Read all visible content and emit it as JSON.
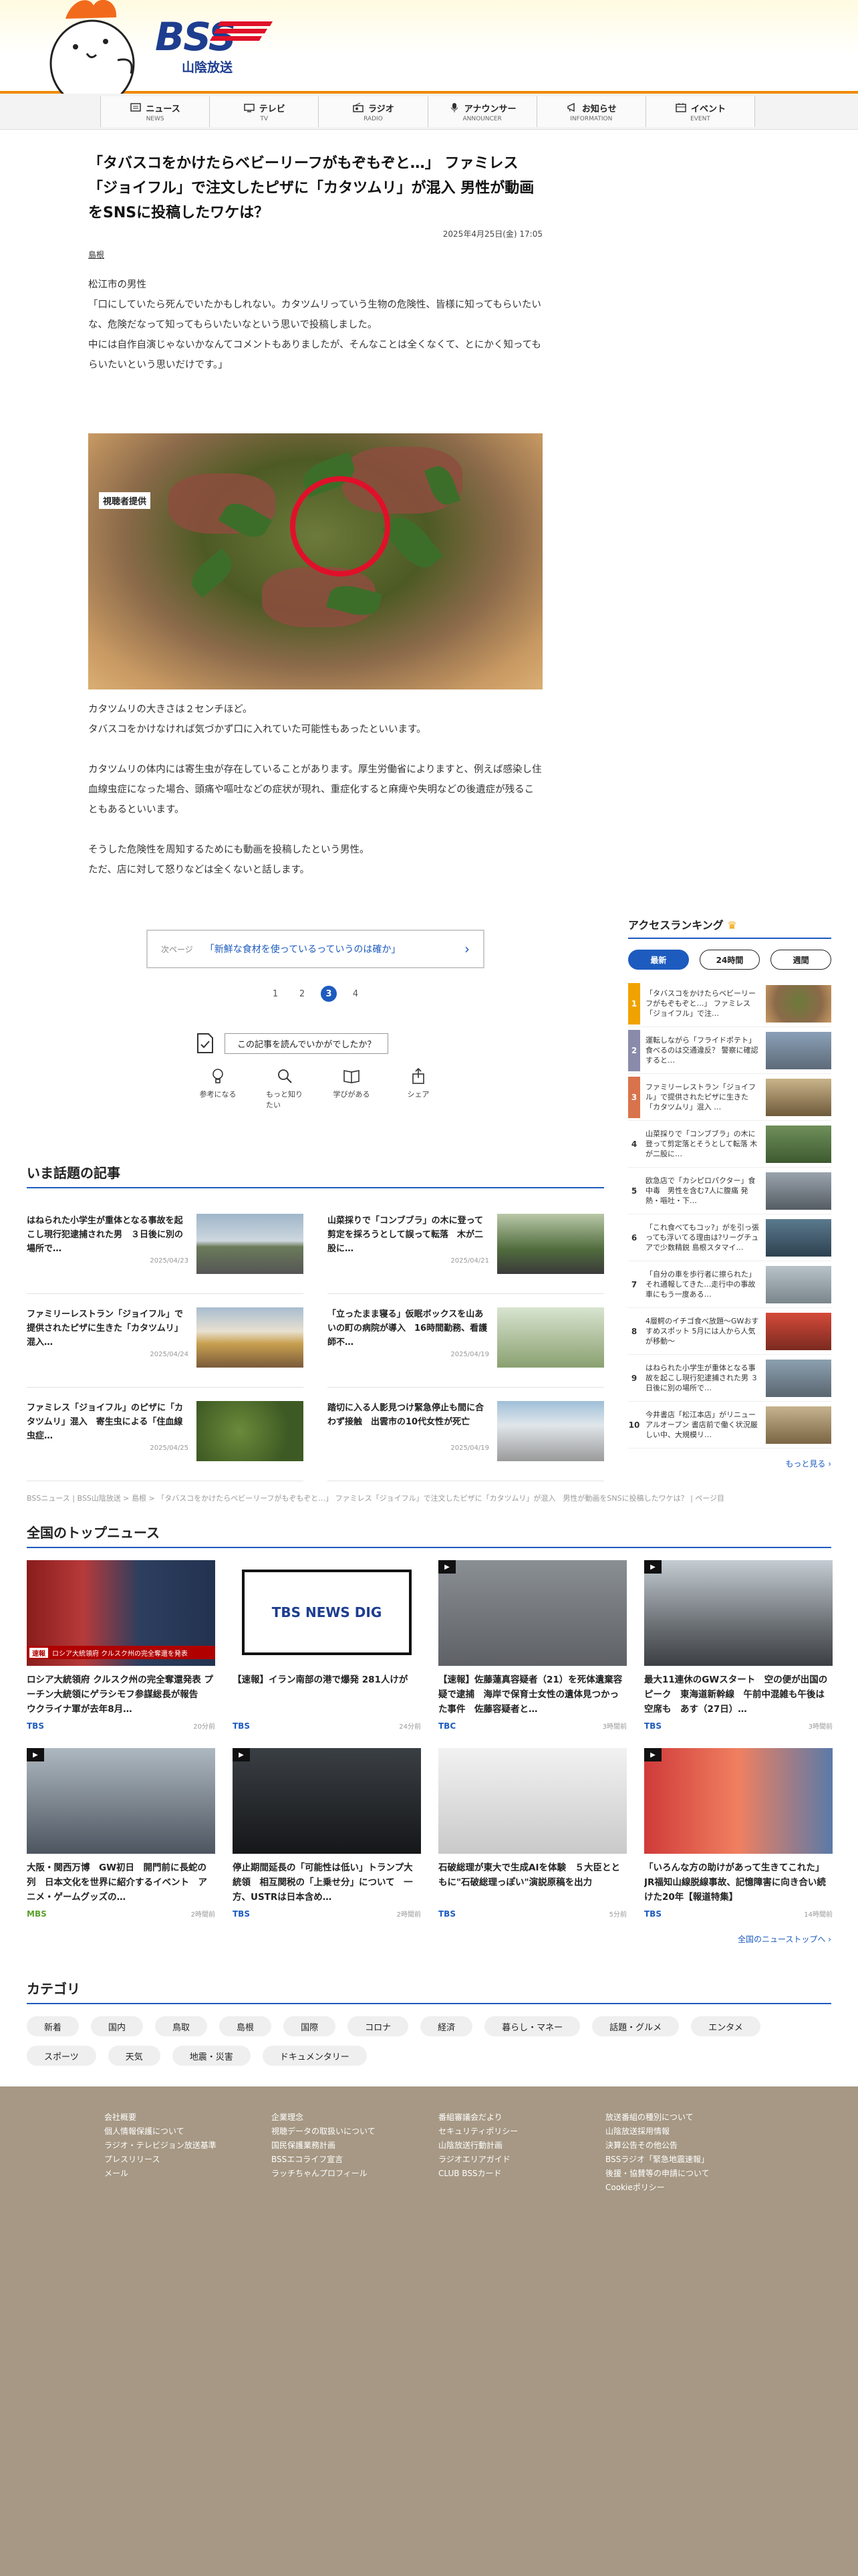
{
  "brand": {
    "logo_text": "BSS",
    "logo_sub": "山陰放送"
  },
  "nav": [
    {
      "label": "ニュース",
      "en": "NEWS",
      "icon": "news-icon"
    },
    {
      "label": "テレビ",
      "en": "TV",
      "icon": "tv-icon"
    },
    {
      "label": "ラジオ",
      "en": "RADIO",
      "icon": "radio-icon"
    },
    {
      "label": "アナウンサー",
      "en": "ANNOUNCER",
      "icon": "microphone-icon"
    },
    {
      "label": "お知らせ",
      "en": "INFORMATION",
      "icon": "megaphone-icon"
    },
    {
      "label": "イベント",
      "en": "EVENT",
      "icon": "calendar-icon"
    }
  ],
  "article": {
    "title": "「タバスコをかけたらベビーリーフがもぞもぞと…」 ファミレス「ジョイフル」で注文したピザに「カタツムリ」が混入 男性が動画をSNSに投稿したワケは？",
    "date": "2025年4月25日(金) 17:05",
    "category": "島根",
    "para1": [
      "松江市の男性",
      "「口にしていたら死んでいたかもしれない。カタツムリっていう生物の危険性、皆様に知ってもらいたいな、危険だなって知ってもらいたいなという思いで投稿しました。",
      "中には自作自演じゃないかなんてコメントもありましたが、そんなことは全くなくて、とにかく知ってもらいたいという思いだけです。」"
    ],
    "photo_credit": "視聴者提供",
    "para2": [
      "カタツムリの大きさは２センチほど。",
      "タバスコをかけなければ気づかず口に入れていた可能性もあったといいます。"
    ],
    "para3": [
      "カタツムリの体内には寄生虫が存在していることがあります。厚生労働省によりますと、例えば感染し住血線虫症になった場合、頭痛や嘔吐などの症状が現れ、重症化すると麻痺や失明などの後遺症が残ることもあるといいます。"
    ],
    "para4": [
      "そうした危険性を周知するためにも動画を投稿したという男性。",
      "ただ、店に対して怒りなどは全くないと話します。"
    ]
  },
  "next_page": {
    "label": "次ページ",
    "text": "「新鮮な食材を使っているっていうのは確か」",
    "arrow": "›"
  },
  "pagination": [
    "1",
    "2",
    "3",
    "4"
  ],
  "pagination_current": "3",
  "feedback": {
    "question": "この記事を読んでいかがでしたか？",
    "options": [
      {
        "label": "参考になる",
        "icon": "lightbulb-icon"
      },
      {
        "label": "もっと知りたい",
        "icon": "search-icon"
      },
      {
        "label": "学びがある",
        "icon": "book-icon"
      },
      {
        "label": "シェア",
        "icon": "share-icon"
      }
    ]
  },
  "ranking": {
    "title": "アクセスランキング",
    "tabs": [
      "最新",
      "24時間",
      "週間"
    ],
    "active_tab": "最新",
    "items": [
      {
        "rank": "1",
        "text": "「タバスコをかけたらベビーリーフがもぞもぞと…」 ファミレス「ジョイフル」で注…"
      },
      {
        "rank": "2",
        "text": "運転しながら「フライドポテト」食べるのは交通違反？ 警察に確認すると…"
      },
      {
        "rank": "3",
        "text": "ファミリーレストラン「ジョイフル」で提供されたピザに生きた「カタツムリ」混入 …"
      },
      {
        "rank": "4",
        "text": "山菜採りで「コンブブラ」の木に登って剪定落とそうとして転落 木が二股に…"
      },
      {
        "rank": "5",
        "text": "欧急店で「カシピロパクター」食中毒　男性を含む7人に腹痛 発熱・嘔吐・下…"
      },
      {
        "rank": "6",
        "text": "「これ食べてもコッ?」がを引っ張っても浮いてる理由は?リーグチュアで少数精鋭 島根スタマイ…"
      },
      {
        "rank": "7",
        "text": "「自分の車を歩行者に擦られた」それ通報してきた…走行中の事故車にもう一度ある…"
      },
      {
        "rank": "8",
        "text": "4層鰐のイチゴ食べ放題～GWおすすめスポット 5月には人から人気が移動～"
      },
      {
        "rank": "9",
        "text": "はねられた小学生が重体となる事故を起こし現行犯逮捕された男 ３日後に別の場所で…"
      },
      {
        "rank": "10",
        "text": "今井書店「松江本店」がリニューアルオープン 書店前で働く状況厳しい中、大規模リ…"
      }
    ],
    "more": "もっと見る ›"
  },
  "hot_topics": {
    "title": "いま話題の記事",
    "items": [
      {
        "title": "はねられた小学生が重体となる事故を起こし現行犯逮捕された男　３日後に別の場所で…",
        "date": "2025/04/23"
      },
      {
        "title": "山菜採りで「コンブブラ」の木に登って剪定を採ろうとして誤って転落　木が二股に…",
        "date": "2025/04/21"
      },
      {
        "title": "ファミリーレストラン「ジョイフル」で提供されたピザに生きた「カタツムリ」混入…",
        "date": "2025/04/24"
      },
      {
        "title": "「立ったまま寝る」仮眠ボックスを山あいの町の病院が導入　16時間勤務、看護師不…",
        "date": "2025/04/19"
      },
      {
        "title": "ファミレス「ジョイフル」のピザに「カタツムリ」混入　寄生虫による「住血線虫症…",
        "date": "2025/04/25"
      },
      {
        "title": "踏切に入る人影見つけ緊急停止も間に合わず接触　出雲市の10代女性が死亡",
        "date": "2025/04/19"
      }
    ]
  },
  "breadcrumb": "BSSニュース | BSS山陰放送 > 島根 > 「タバスコをかけたらベビーリーフがもぞもぞと…」 ファミレス「ジョイフル」で注文したピザに「カタツムリ」が混入　男性が動画をSNSに投稿したワケは？ | ページ目",
  "national": {
    "title": "全国のトップニュース",
    "items": [
      {
        "title": "ロシア大統領府 クルスク州の完全奪還発表 プーチン大統領にゲラシモフ参謀総長が報告　ウクライナ軍が去年8月…",
        "source": "TBS",
        "ago": "20分前",
        "video": false,
        "img": "putin"
      },
      {
        "title": "【速報】イラン南部の港で爆発 281人けが",
        "source": "TBS",
        "ago": "24分前",
        "video": false,
        "img": "newsdig"
      },
      {
        "title": "【速報】佐藤蓮真容疑者（21）を死体遺棄容疑で逮捕　海岸で保育士女性の遺体見つかった事件　佐藤容疑者と…",
        "source": "TBC",
        "ago": "3時間前",
        "video": true,
        "img": "rubble"
      },
      {
        "title": "最大11連休のGWスタート　空の便が出国のピーク　東海道新幹線　午前中混雑も午後は空席も　あす（27日）…",
        "source": "TBS",
        "ago": "3時間前",
        "video": true,
        "img": "crowd"
      },
      {
        "title": "大阪・関西万博　GW初日　開門前に長蛇の列　日本文化を世界に紹介するイベント　アニメ・ゲームグッズの…",
        "source": "MBS",
        "ago": "2時間前",
        "video": true,
        "img": "expo"
      },
      {
        "title": "停止期間延長の「可能性は低い」トランプ大統領　相互関税の「上乗せ分」について　一方、USTRは日本含め…",
        "source": "TBS",
        "ago": "2時間前",
        "video": true,
        "img": "trump"
      },
      {
        "title": "石破総理が東大で生成AIを体験　５大臣とともに\"石破総理っぽい\"演説原稿を出力",
        "source": "TBS",
        "ago": "5分前",
        "video": false,
        "img": "ishiba"
      },
      {
        "title": "「いろんな方の助けがあって生きてこれた」JR福知山線脱線事故、記憶障害に向き合い続けた20年【報道特集】",
        "source": "TBS",
        "ago": "14時間前",
        "video": true,
        "img": "woman"
      }
    ],
    "more": "全国のニューストップへ ›",
    "breaking": "速報",
    "ticker": "ロシア大統領府 クルスク州の完全奪還を発表",
    "newsdig": "TBS NEWS DIG"
  },
  "categories": {
    "title": "カテゴリ",
    "items": [
      "新着",
      "国内",
      "鳥取",
      "島根",
      "国際",
      "コロナ",
      "経済",
      "暮らし・マネー",
      "話題・グルメ",
      "エンタメ",
      "スポーツ",
      "天気",
      "地震・災害",
      "ドキュメンタリー"
    ]
  },
  "footer": {
    "col1": [
      "会社概要",
      "個人情報保護について",
      "ラジオ・テレビジョン放送基準",
      "プレスリリース",
      "メール"
    ],
    "col2": [
      "企業理念",
      "視聴データの取扱いについて",
      "国民保護業務計画",
      "BSSエコライフ宣言",
      "ラッチちゃんプロフィール"
    ],
    "col3": [
      "番組審議会だより",
      "セキュリティポリシー",
      "山陰放送行動計画",
      "ラジオエリアガイド",
      "CLUB BSSカード"
    ],
    "col4": [
      "放送番組の種別について",
      "山陰放送採用情報",
      "決算公告その他公告",
      "BSSラジオ「緊急地震速報」",
      "後援・協賛等の申請について",
      "Cookieポリシー"
    ]
  },
  "colors": {
    "accent": "#1d5bbf",
    "header_border": "#f08a00",
    "footer_bg": "#a69884",
    "photo_ring": "#e0102a"
  }
}
